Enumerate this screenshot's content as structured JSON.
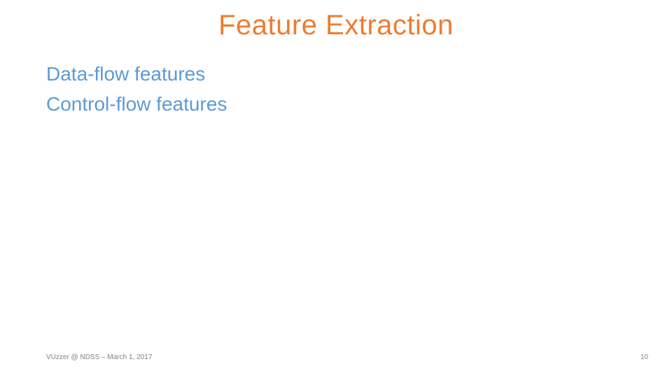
{
  "title": "Feature Extraction",
  "items": [
    "Data-flow features",
    "Control-flow features"
  ],
  "footer_left": "VUzzer @ NDSS – March 1, 2017",
  "page_number": "10"
}
